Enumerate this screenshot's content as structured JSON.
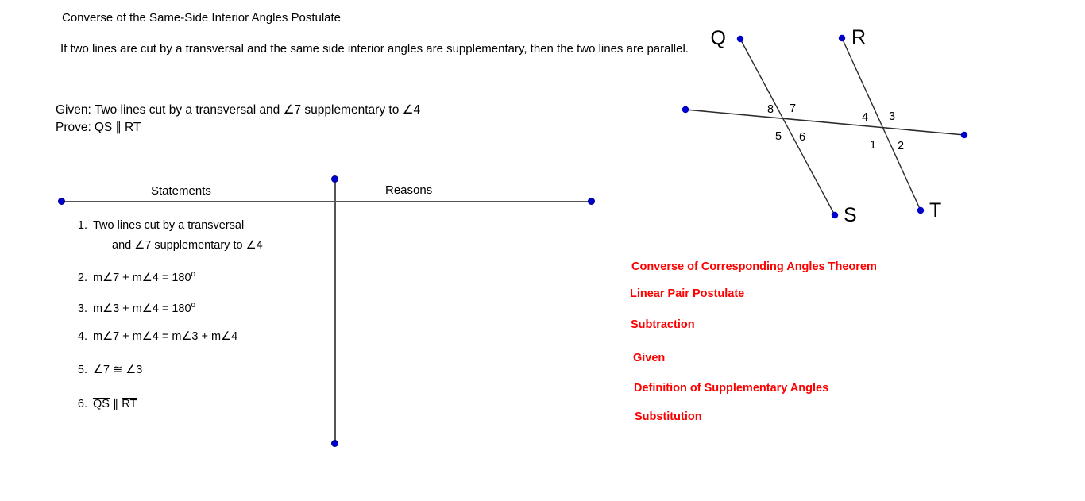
{
  "title": "Converse of the Same-Side Interior Angles Postulate",
  "theorem": "If two lines are cut by a transversal and the same side interior angles are supplementary, then the two lines are parallel.",
  "given": {
    "label": "Given: Two lines cut by a transversal and ∠7 supplementary to ∠4"
  },
  "prove": {
    "label": "Prove:",
    "segment_1": "QS",
    "parallel_symbol": "∥",
    "segment_2": "RT"
  },
  "table": {
    "header_statements": "Statements",
    "header_reasons": "Reasons",
    "statements": [
      {
        "number": "1.",
        "line_1": "Two lines cut by a transversal",
        "line_2": "and ∠7 supplementary to ∠4"
      },
      {
        "number": "2.",
        "line_1": "m∠7 + m∠4 = 180",
        "degree": "o"
      },
      {
        "number": "3.",
        "line_1": "m∠3 + m∠4 = 180",
        "degree": "o"
      },
      {
        "number": "4.",
        "line_1": "m∠7 + m∠4 = m∠3 + m∠4"
      },
      {
        "number": "5.",
        "line_1": "∠7 ≅ ∠3"
      },
      {
        "number": "6.",
        "segment_1": "QS",
        "parallel_symbol": "∥",
        "segment_2": "RT"
      }
    ]
  },
  "reasons": [
    "Converse of Corresponding Angles Theorem",
    "Linear Pair Postulate",
    "Subtraction",
    "Given",
    "Definition of Supplementary Angles",
    "Substitution"
  ],
  "diagram": {
    "point_labels": [
      "Q",
      "R",
      "S",
      "T"
    ],
    "angle_labels": [
      "8",
      "7",
      "5",
      "6",
      "4",
      "3",
      "1",
      "2"
    ],
    "colors": {
      "point_dot": "#0000cc",
      "line": "#2b2b2b",
      "reason_text": "#fe0000"
    }
  }
}
